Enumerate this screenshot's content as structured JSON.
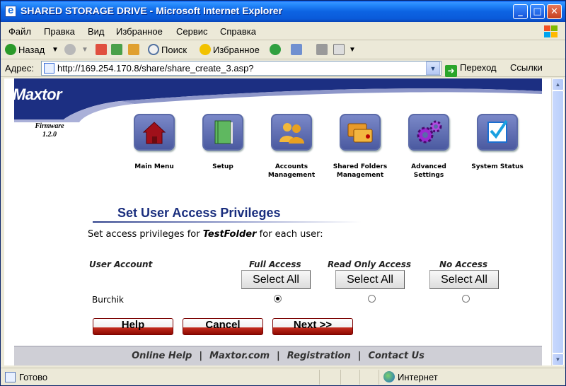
{
  "window": {
    "title": "SHARED STORAGE DRIVE - Microsoft Internet Explorer",
    "minimize": "_",
    "maximize": "□",
    "close": "✕"
  },
  "menu": [
    "Файл",
    "Правка",
    "Вид",
    "Избранное",
    "Сервис",
    "Справка"
  ],
  "toolbar": {
    "back": "Назад",
    "search": "Поиск",
    "favorites": "Избранное"
  },
  "address": {
    "label": "Адрес:",
    "url": "http://169.254.170.8/share/share_create_3.asp?",
    "go": "Переход",
    "links": "Ссылки"
  },
  "brand": {
    "logo": "Maxtor",
    "firmware_label": "Firmware",
    "firmware_version": "1.2.0"
  },
  "nav": [
    {
      "label": "Main Menu",
      "icon": "house-icon"
    },
    {
      "label": "Setup",
      "icon": "book-icon"
    },
    {
      "label": "Accounts Management",
      "icon": "users-icon"
    },
    {
      "label": "Shared Folders Management",
      "icon": "folders-icon"
    },
    {
      "label": "Advanced Settings",
      "icon": "gears-icon"
    },
    {
      "label": "System Status",
      "icon": "checkmark-icon"
    }
  ],
  "page": {
    "title": "Set User Access Privileges",
    "desc_prefix": "Set access privileges for",
    "folder": "TestFolder",
    "desc_suffix": "for each user:"
  },
  "table": {
    "user_col": "User Account",
    "columns": [
      "Full Access",
      "Read Only Access",
      "No Access"
    ],
    "select_all": "Select All",
    "rows": [
      {
        "user": "Burchik",
        "selected": "Full Access"
      }
    ]
  },
  "actions": {
    "help": "Help",
    "cancel": "Cancel",
    "next": "Next >>"
  },
  "footer": [
    "Online Help",
    "Maxtor.com",
    "Registration",
    "Contact Us"
  ],
  "footer_sep": "|",
  "status": {
    "text": "Готово",
    "zone": "Интернет"
  },
  "colors": {
    "banner": "#1c2f82",
    "title": "#1a2e7e",
    "action_button_red": "#c52b1e"
  }
}
